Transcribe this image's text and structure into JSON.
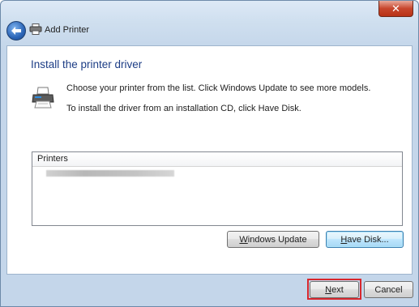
{
  "window": {
    "title": "Add Printer",
    "close_symbol": "✕"
  },
  "page": {
    "heading": "Install the printer driver",
    "instruction_1": "Choose your printer from the list. Click Windows Update to see more models.",
    "instruction_2": "To install the driver from an installation CD, click Have Disk."
  },
  "printers_list": {
    "header": "Printers",
    "items": [
      "(blurred printer name)"
    ]
  },
  "buttons": {
    "windows_update": {
      "prefix": "",
      "mnemonic": "W",
      "rest": "indows Update"
    },
    "have_disk": {
      "prefix": "",
      "mnemonic": "H",
      "rest": "ave Disk..."
    },
    "next": {
      "prefix": "",
      "mnemonic": "N",
      "rest": "ext"
    },
    "cancel": "Cancel"
  },
  "icons": {
    "back": "back-arrow-icon",
    "title": "printer-icon",
    "page": "printer-icon"
  },
  "colors": {
    "heading": "#1c3d85",
    "highlight": "#d8272d",
    "chrome": "#c4d6ea"
  }
}
